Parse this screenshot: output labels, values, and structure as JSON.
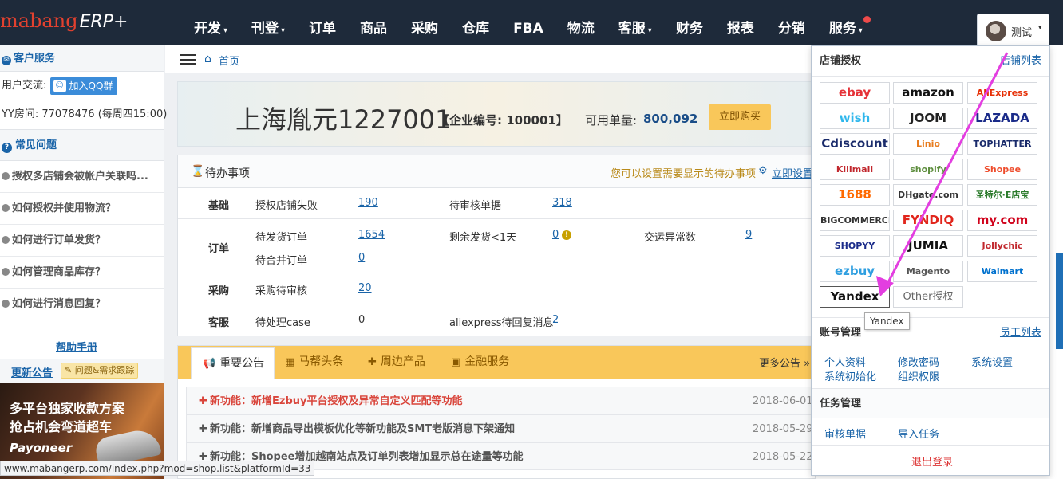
{
  "logo": {
    "brand": "mabang",
    "product": "ERP+"
  },
  "nav": [
    {
      "label": "开发",
      "caret": "▾"
    },
    {
      "label": "刊登",
      "caret": "▾"
    },
    {
      "label": "订单"
    },
    {
      "label": "商品"
    },
    {
      "label": "采购"
    },
    {
      "label": "仓库"
    },
    {
      "label": "FBA"
    },
    {
      "label": "物流"
    },
    {
      "label": "客服",
      "caret": "▾"
    },
    {
      "label": "财务"
    },
    {
      "label": "报表"
    },
    {
      "label": "分销"
    },
    {
      "label": "服务",
      "caret": "▾"
    }
  ],
  "user": {
    "name": "测试",
    "caret": "▾"
  },
  "sidebar": {
    "service_title": "客户服务",
    "exchange_label": "用户交流:",
    "qq_button": "加入QQ群",
    "yy_room": "YY房间: 77078476 (每周四15:00)",
    "faq_title": "常见问题",
    "faq_items": [
      "授权多店铺会被帐户关联吗...",
      "如何授权并使用物流？",
      "如何进行订单发货？",
      "如何管理商品库存？",
      "如何进行消息回复？"
    ],
    "help_link": "帮助手册",
    "update_link": "更新公告",
    "feedback_button": "问题&需求跟踪",
    "banner_line1": "多平台独家收款方案",
    "banner_line2": "抢占机会弯道超车",
    "banner_brand": "Payoneer"
  },
  "breadcrumb": {
    "home": "首页"
  },
  "company": {
    "name": "上海胤元1227001",
    "code": "【企业编号: 100001】",
    "quota_label": "可用单量:",
    "quota_value": "800,092",
    "buy_button": "立即购买"
  },
  "todo": {
    "title": "待办事项",
    "hint": "您可以设置需要显示的待办事项",
    "setting_link": "立即设置",
    "rows": {
      "basic": {
        "cat": "基础",
        "a_label": "授权店铺失败",
        "a_num": "190",
        "b_label": "待审核单据",
        "b_num": "318"
      },
      "order": {
        "cat": "订单",
        "a_label": "待发货订单",
        "a_num": "1654",
        "b_label": "剩余发货<1天",
        "b_num": "0",
        "c_label": "交运异常数",
        "c_num": "9",
        "d_label": "待合并订单",
        "d_num": "0"
      },
      "purchase": {
        "cat": "采购",
        "a_label": "采购待审核",
        "a_num": "20"
      },
      "service": {
        "cat": "客服",
        "a_label": "待处理case",
        "a_num": "0",
        "b_label": "aliexpress待回复消息",
        "b_num": "2"
      }
    }
  },
  "notice": {
    "tabs": [
      "重要公告",
      "马帮头条",
      "周边产品",
      "金融服务"
    ],
    "more": "更多公告 »",
    "items": [
      {
        "text": "新功能：新增Ezbuy平台授权及异常自定义匹配等功能",
        "date": "2018-06-01",
        "color": "#d9453b"
      },
      {
        "text": "新功能：新增商品导出模板优化等新功能及SMT老版消息下架通知",
        "date": "2018-05-29",
        "color": "#555555"
      },
      {
        "text": "新功能：Shopee增加越南站点及订单列表增加显示总在途量等功能",
        "date": "2018-05-22",
        "color": "#555555"
      }
    ]
  },
  "dropdown": {
    "store_title": "店铺授权",
    "store_link": "店铺列表",
    "platforms": [
      {
        "label": "ebay",
        "color": "#e53238"
      },
      {
        "label": "amazon",
        "color": "#111111"
      },
      {
        "label": "AliExpress",
        "color": "#e62e04"
      },
      {
        "label": "wish",
        "color": "#2fb7ec"
      },
      {
        "label": "JOOM",
        "color": "#222222"
      },
      {
        "label": "LAZADA",
        "color": "#1a2b89"
      },
      {
        "label": "Cdiscount",
        "color": "#1a2b6b"
      },
      {
        "label": "Linio",
        "color": "#e87b1c"
      },
      {
        "label": "TOPHATTER",
        "color": "#1a2b6b"
      },
      {
        "label": "Kilimall",
        "color": "#c1272d"
      },
      {
        "label": "shopify",
        "color": "#5e8e3e"
      },
      {
        "label": "Shopee",
        "color": "#ee4d2d"
      },
      {
        "label": "1688",
        "color": "#ff6a00"
      },
      {
        "label": "DHgate.com",
        "color": "#333333"
      },
      {
        "label": "圣特尔·E店宝",
        "color": "#2a7a2a"
      },
      {
        "label": "BIGCOMMERCE",
        "color": "#333333"
      },
      {
        "label": "FYNDIQ",
        "color": "#e1261c"
      },
      {
        "label": "my.com",
        "color": "#d0021b"
      },
      {
        "label": "SHOPYY",
        "color": "#1a2b89"
      },
      {
        "label": "JUMIA",
        "color": "#111111"
      },
      {
        "label": "Jollychic",
        "color": "#c1272d"
      },
      {
        "label": "ezbuy",
        "color": "#2f9fe0"
      },
      {
        "label": "Magento",
        "color": "#555555"
      },
      {
        "label": "Walmart",
        "color": "#0071ce"
      },
      {
        "label": "Yandex",
        "color": "#111111"
      },
      {
        "label": "Other授权",
        "color": "#666666"
      }
    ],
    "tooltip": "Yandex",
    "account_title": "账号管理",
    "account_link": "员工列表",
    "account_items": [
      "个人资料",
      "修改密码",
      "系统设置",
      "系统初始化",
      "组织权限"
    ],
    "task_title": "任务管理",
    "task_items": [
      "审核单据",
      "导入任务"
    ],
    "logout": "退出登录"
  },
  "status_url": "www.mabangerp.com/index.php?mod=shop.list&platformId=33",
  "colors": {
    "nav_bg": "#1e2a3a",
    "accent": "#1a64a8",
    "notice_bar": "#f9c75a",
    "annotation_arrow": "#e33ee0"
  }
}
